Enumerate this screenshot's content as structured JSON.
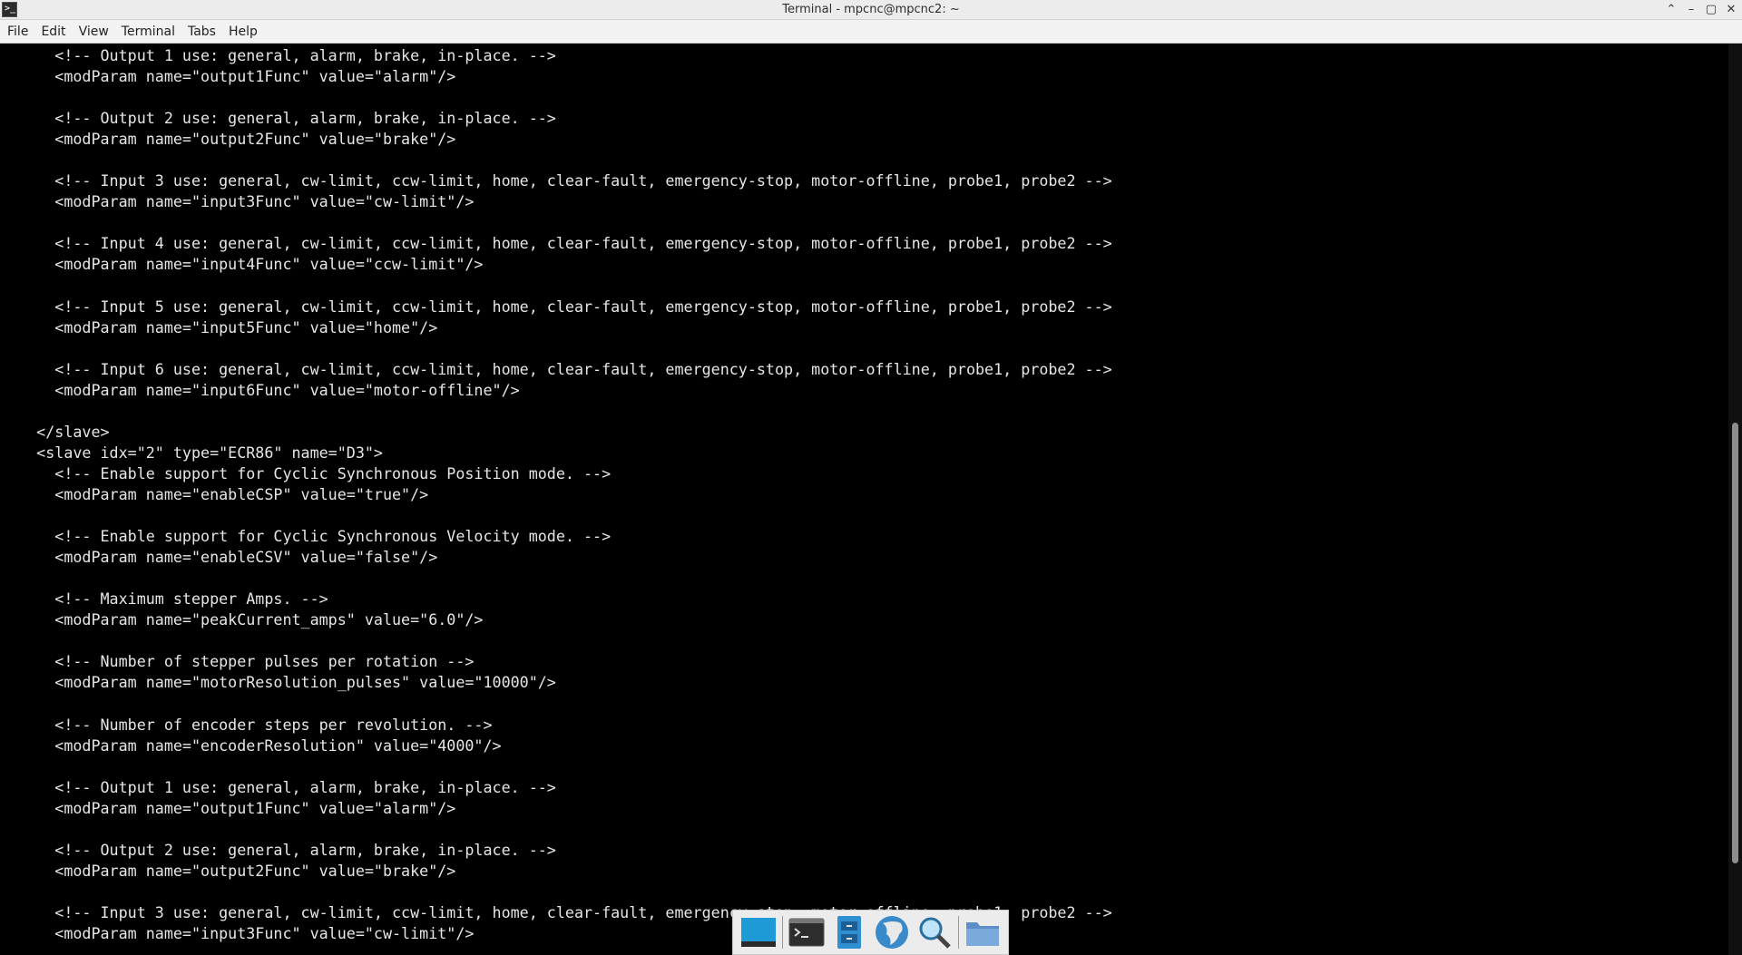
{
  "window": {
    "title": "Terminal - mpcnc@mpcnc2: ~"
  },
  "menu": {
    "items": [
      "File",
      "Edit",
      "View",
      "Terminal",
      "Tabs",
      "Help"
    ]
  },
  "terminal": {
    "lines": [
      "      <!-- Output 1 use: general, alarm, brake, in-place. -->",
      "      <modParam name=\"output1Func\" value=\"alarm\"/>",
      "",
      "      <!-- Output 2 use: general, alarm, brake, in-place. -->",
      "      <modParam name=\"output2Func\" value=\"brake\"/>",
      "",
      "      <!-- Input 3 use: general, cw-limit, ccw-limit, home, clear-fault, emergency-stop, motor-offline, probe1, probe2 -->",
      "      <modParam name=\"input3Func\" value=\"cw-limit\"/>",
      "",
      "      <!-- Input 4 use: general, cw-limit, ccw-limit, home, clear-fault, emergency-stop, motor-offline, probe1, probe2 -->",
      "      <modParam name=\"input4Func\" value=\"ccw-limit\"/>",
      "",
      "      <!-- Input 5 use: general, cw-limit, ccw-limit, home, clear-fault, emergency-stop, motor-offline, probe1, probe2 -->",
      "      <modParam name=\"input5Func\" value=\"home\"/>",
      "",
      "      <!-- Input 6 use: general, cw-limit, ccw-limit, home, clear-fault, emergency-stop, motor-offline, probe1, probe2 -->",
      "      <modParam name=\"input6Func\" value=\"motor-offline\"/>",
      "",
      "    </slave>",
      "    <slave idx=\"2\" type=\"ECR86\" name=\"D3\">",
      "      <!-- Enable support for Cyclic Synchronous Position mode. -->",
      "      <modParam name=\"enableCSP\" value=\"true\"/>",
      "",
      "      <!-- Enable support for Cyclic Synchronous Velocity mode. -->",
      "      <modParam name=\"enableCSV\" value=\"false\"/>",
      "",
      "      <!-- Maximum stepper Amps. -->",
      "      <modParam name=\"peakCurrent_amps\" value=\"6.0\"/>",
      "",
      "      <!-- Number of stepper pulses per rotation -->",
      "      <modParam name=\"motorResolution_pulses\" value=\"10000\"/>",
      "",
      "      <!-- Number of encoder steps per revolution. -->",
      "      <modParam name=\"encoderResolution\" value=\"4000\"/>",
      "",
      "      <!-- Output 1 use: general, alarm, brake, in-place. -->",
      "      <modParam name=\"output1Func\" value=\"alarm\"/>",
      "",
      "      <!-- Output 2 use: general, alarm, brake, in-place. -->",
      "      <modParam name=\"output2Func\" value=\"brake\"/>",
      "",
      "      <!-- Input 3 use: general, cw-limit, ccw-limit, home, clear-fault, emergency-stop, motor-offline, probe1, probe2 -->",
      "      <modParam name=\"input3Func\" value=\"cw-limit\"/>"
    ]
  },
  "dock": {
    "items": [
      "show-desktop-icon",
      "terminal-icon",
      "file-manager-icon",
      "web-browser-icon",
      "app-finder-icon",
      "folder-icon"
    ]
  },
  "colors": {
    "terminal_bg": "#000000",
    "terminal_fg": "#e6e6e6",
    "titlebar_bg": "#ececec"
  }
}
